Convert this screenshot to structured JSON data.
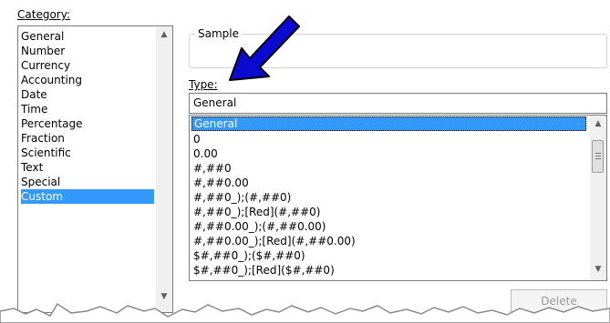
{
  "category": {
    "label": "Category:",
    "items": [
      "General",
      "Number",
      "Currency",
      "Accounting",
      "Date",
      "Time",
      "Percentage",
      "Fraction",
      "Scientific",
      "Text",
      "Special",
      "Custom"
    ],
    "selected": "Custom"
  },
  "sample": {
    "label": "Sample",
    "value": ""
  },
  "type": {
    "label": "Type:",
    "value": "General",
    "formats": [
      "General",
      "0",
      "0.00",
      "#,##0",
      "#,##0.00",
      "#,##0_);(#,##0)",
      "#,##0_);[Red](#,##0)",
      "#,##0.00_);(#,##0.00)",
      "#,##0.00_);[Red](#,##0.00)",
      "$#,##0_);($#,##0)",
      "$#,##0_);[Red]($#,##0)"
    ],
    "selected": "General"
  },
  "buttons": {
    "delete_label": "Delete"
  },
  "annotation": {
    "arrow_color": "#0a0ad0"
  },
  "colors": {
    "selection": "#3399ff"
  }
}
